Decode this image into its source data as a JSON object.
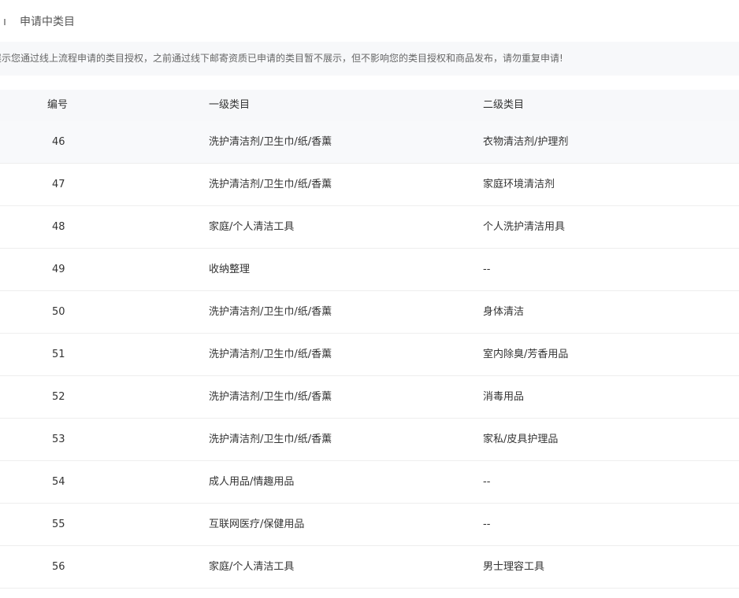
{
  "section": {
    "title": "申请中类目"
  },
  "notice": {
    "text": "展示您通过线上流程申请的类目授权，之前通过线下邮寄资质已申请的类目暂不展示，但不影响您的类目授权和商品发布，请勿重复申请!"
  },
  "table": {
    "headers": {
      "no": "编号",
      "level1": "一级类目",
      "level2": "二级类目"
    },
    "rows": [
      {
        "no": "46",
        "level1": "洗护清洁剂/卫生巾/纸/香薰",
        "level2": "衣物清洁剂/护理剂"
      },
      {
        "no": "47",
        "level1": "洗护清洁剂/卫生巾/纸/香薰",
        "level2": "家庭环境清洁剂"
      },
      {
        "no": "48",
        "level1": "家庭/个人清洁工具",
        "level2": "个人洗护清洁用具"
      },
      {
        "no": "49",
        "level1": "收纳整理",
        "level2": "--"
      },
      {
        "no": "50",
        "level1": "洗护清洁剂/卫生巾/纸/香薰",
        "level2": "身体清洁"
      },
      {
        "no": "51",
        "level1": "洗护清洁剂/卫生巾/纸/香薰",
        "level2": "室内除臭/芳香用品"
      },
      {
        "no": "52",
        "level1": "洗护清洁剂/卫生巾/纸/香薰",
        "level2": "消毒用品"
      },
      {
        "no": "53",
        "level1": "洗护清洁剂/卫生巾/纸/香薰",
        "level2": "家私/皮具护理品"
      },
      {
        "no": "54",
        "level1": "成人用品/情趣用品",
        "level2": "--"
      },
      {
        "no": "55",
        "level1": "互联网医疗/保健用品",
        "level2": "--"
      },
      {
        "no": "56",
        "level1": "家庭/个人清洁工具",
        "level2": "男士理容工具"
      }
    ]
  }
}
